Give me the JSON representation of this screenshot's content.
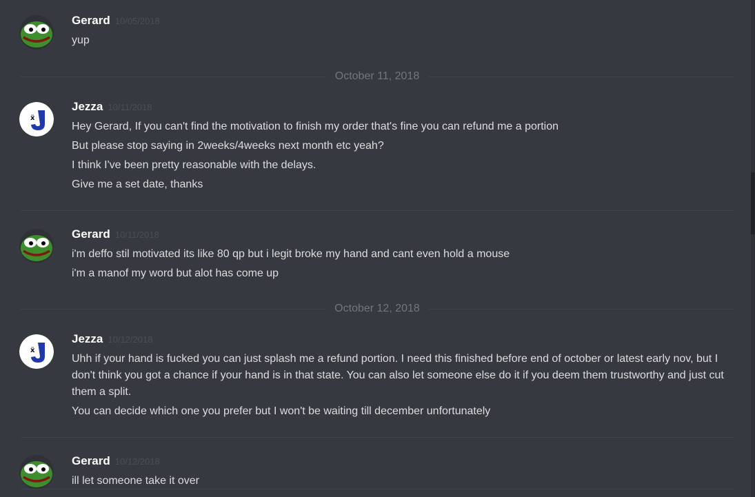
{
  "messages": {
    "g1": {
      "username": "Gerard",
      "timestamp": "10/05/2018",
      "lines": [
        "yup"
      ]
    },
    "divider1": "October 11, 2018",
    "j1": {
      "username": "Jezza",
      "timestamp": "10/11/2018",
      "lines": [
        "Hey Gerard, If you can't find the motivation to finish my order that's fine you can refund me a portion",
        "But please stop saying in 2weeks/4weeks next month etc yeah?",
        "I think I've been pretty reasonable with the delays.",
        "Give me a set date, thanks"
      ]
    },
    "g2": {
      "username": "Gerard",
      "timestamp": "10/11/2018",
      "lines": [
        "i'm deffo stil motivated its like 80 qp but i legit broke my hand and cant even hold a mouse",
        "i'm a manof my word but alot has come up"
      ]
    },
    "divider2": "October 12, 2018",
    "j2": {
      "username": "Jezza",
      "timestamp": "10/12/2018",
      "lines": [
        "Uhh if your hand is fucked you can just splash me a refund portion. I need this finished before end of october or latest early nov, but I don't think you got a chance if your hand is in that state. You can also let someone else do it if you deem them trustworthy and just cut them a split.",
        "You can decide which one you prefer but I won't be waiting till december unfortunately"
      ]
    },
    "g3": {
      "username": "Gerard",
      "timestamp": "10/12/2018",
      "lines": [
        "ill let someone take it over"
      ]
    }
  },
  "colors": {
    "background": "#36393f",
    "username": "#ffffff",
    "text": "#dcddde",
    "timestamp": "#4a4f57",
    "divider_text": "#72767d"
  },
  "icons": {
    "gerard_avatar": "pepe-frog-avatar",
    "jezza_avatar": "letter-j-avatar"
  }
}
